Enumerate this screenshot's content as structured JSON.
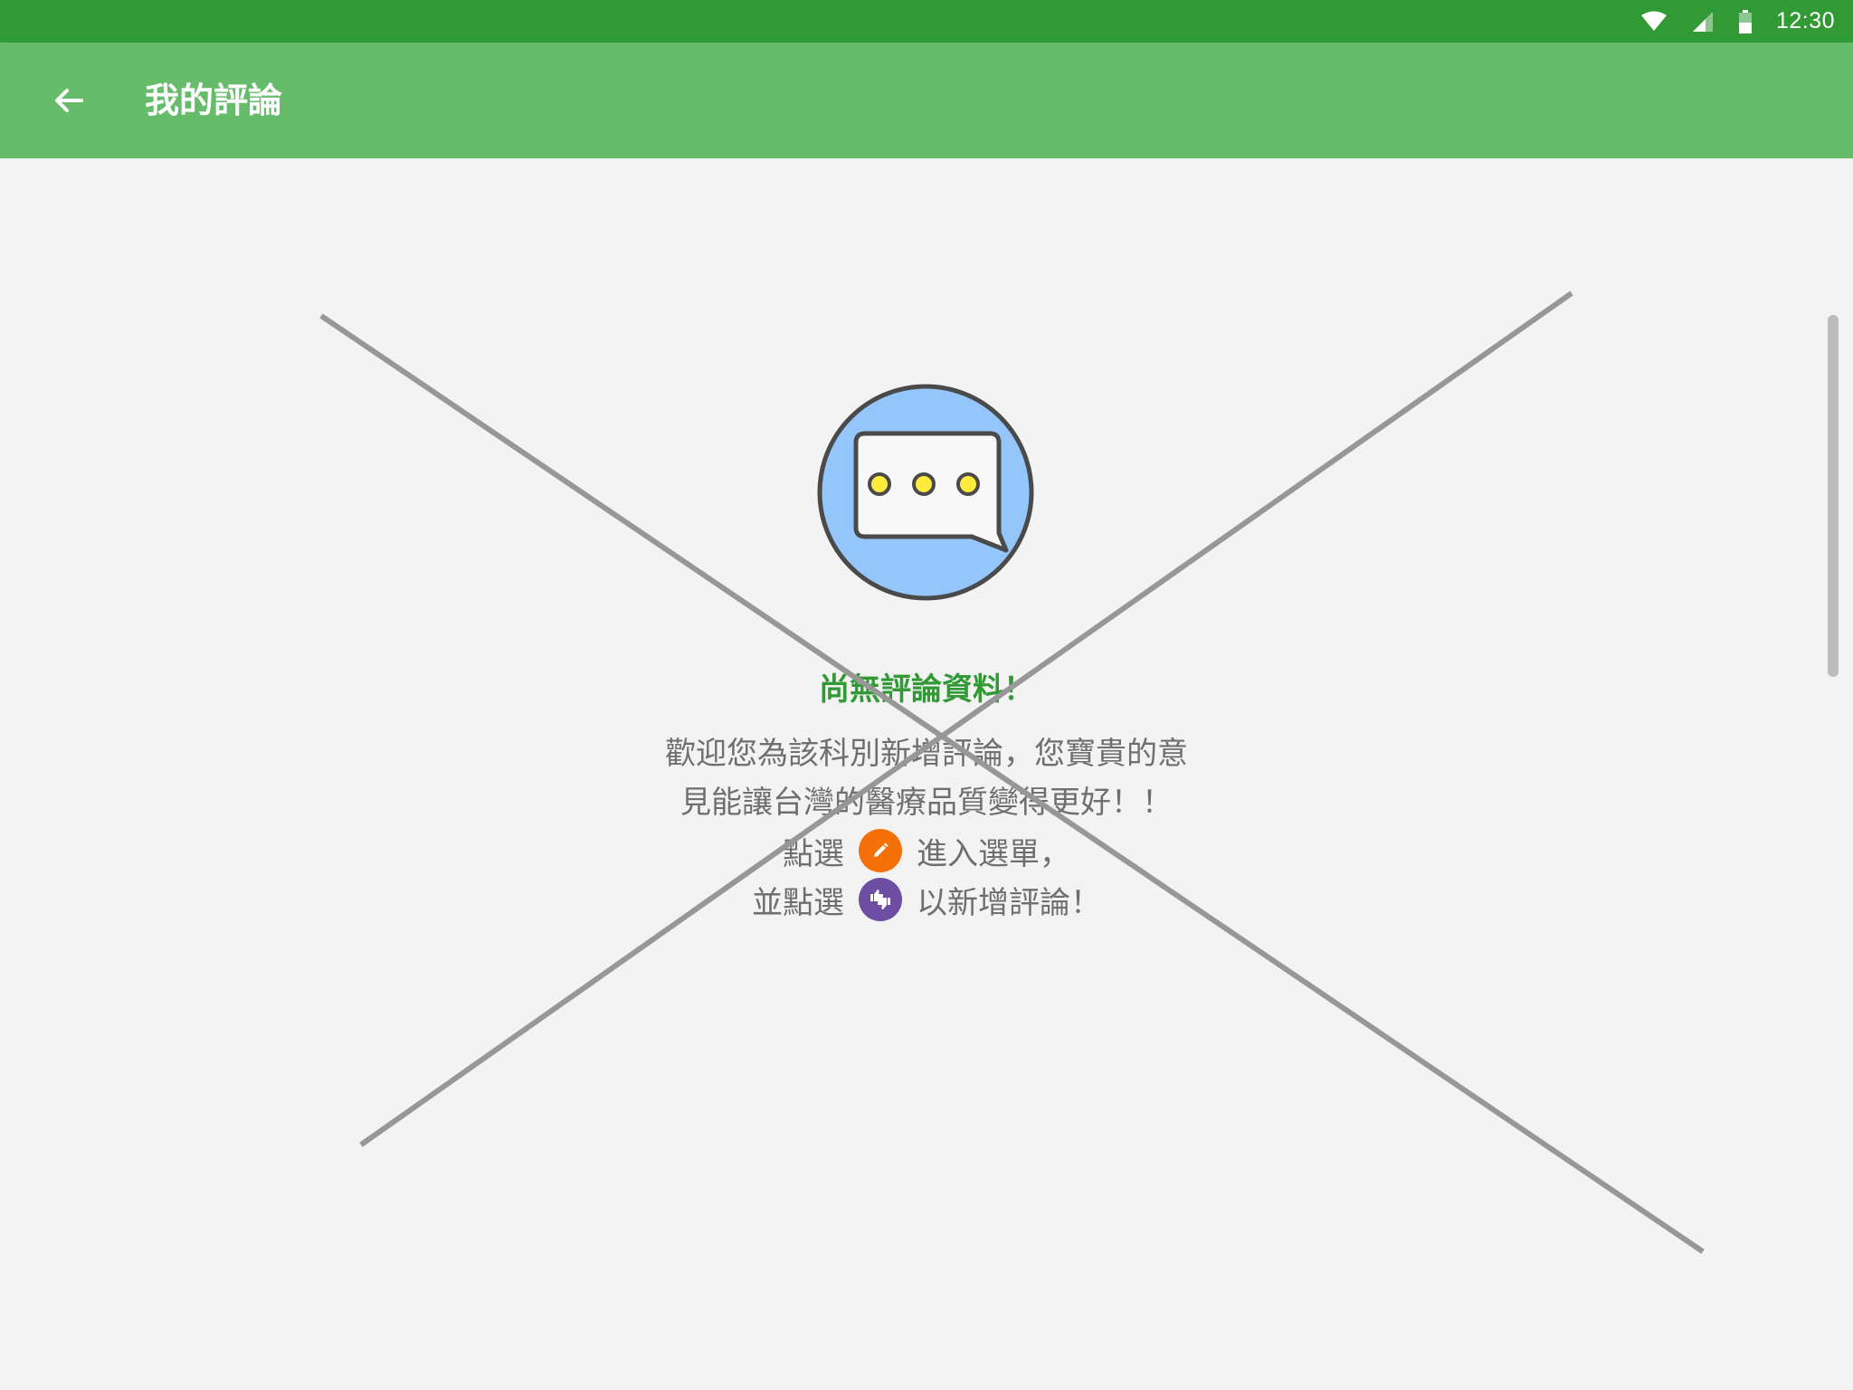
{
  "status_bar": {
    "time": "12:30",
    "icons": [
      "wifi-icon",
      "cell-signal-icon",
      "battery-icon"
    ]
  },
  "app_bar": {
    "back_icon": "arrow-back-icon",
    "title": "我的評論"
  },
  "empty_state": {
    "illustration_icon": "chat-bubble-icon",
    "title": "尚無評論資料！",
    "message_line1": "歡迎您為該科別新增評論，您寶貴的意",
    "message_line2": "見能讓台灣的醫療品質變得更好！！",
    "hint1_before": "點選",
    "hint1_icon": "pencil-icon",
    "hint1_after": "進入選單，",
    "hint2_before": "並點選",
    "hint2_icon": "thumbs-icon",
    "hint2_after": "以新增評論！"
  },
  "colors": {
    "status_bar": "#319a35",
    "app_bar": "#66bc6a",
    "accent_green": "#319a35",
    "orange_badge": "#f57007",
    "purple_badge": "#6e4ea3",
    "illustration_bg": "#94c5fb",
    "dots": "#ffeb3b"
  }
}
